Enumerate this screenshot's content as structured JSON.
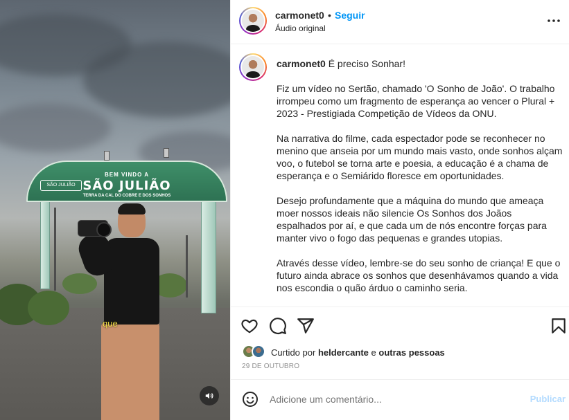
{
  "video": {
    "sign_welcome": "BEM VINDO A",
    "sign_city": "SÃO JULIÃO",
    "sign_subtitle": "TERRA DA CAL DO COBRE E DOS SONHOS",
    "sign_logo": "SÃO JULIÃO",
    "caption": "que",
    "mute_icon": "speaker-icon"
  },
  "header": {
    "username": "carmonet0",
    "separator": "•",
    "follow_label": "Seguir",
    "audio_label": "Áudio original",
    "more_icon": "more-options-icon"
  },
  "post": {
    "username": "carmonet0",
    "title_text": "É preciso Sonhar!",
    "paragraphs": [
      "Fiz um vídeo no Sertão, chamado 'O Sonho de João'. O trabalho irrompeu como um fragmento de esperança ao vencer o Plural + 2023 - Prestigiada Competição de Vídeos da ONU.",
      "Na narrativa do filme, cada espectador pode se reconhecer no menino que anseia por um mundo mais vasto, onde sonhos alçam voo, o futebol se torna arte e poesia, a educação é a chama de esperança e o Semiárido floresce em oportunidades.",
      "Desejo profundamente que a máquina do mundo que ameaça moer nossos ideais não silencie Os Sonhos dos Joãos espalhados por aí, e que cada um de nós encontre forças para manter vivo o fogo das pequenas e grandes utopias.",
      "Através desse vídeo, lembre-se do seu sonho de criança! E que o futuro ainda abrace os sonhos que desenhávamos quando a vida nos escondia o quão árduo o caminho seria."
    ]
  },
  "likes": {
    "prefix": "Curtido por",
    "user": "heldercante",
    "connector": "e",
    "others": "outras pessoas"
  },
  "date": "29 DE OUTUBRO",
  "comment_box": {
    "placeholder": "Adicione um comentário...",
    "publish_label": "Publicar"
  },
  "colors": {
    "accent": "#0095f6",
    "publish_disabled": "#b3dbff",
    "muted_text": "#8e8e8e"
  }
}
